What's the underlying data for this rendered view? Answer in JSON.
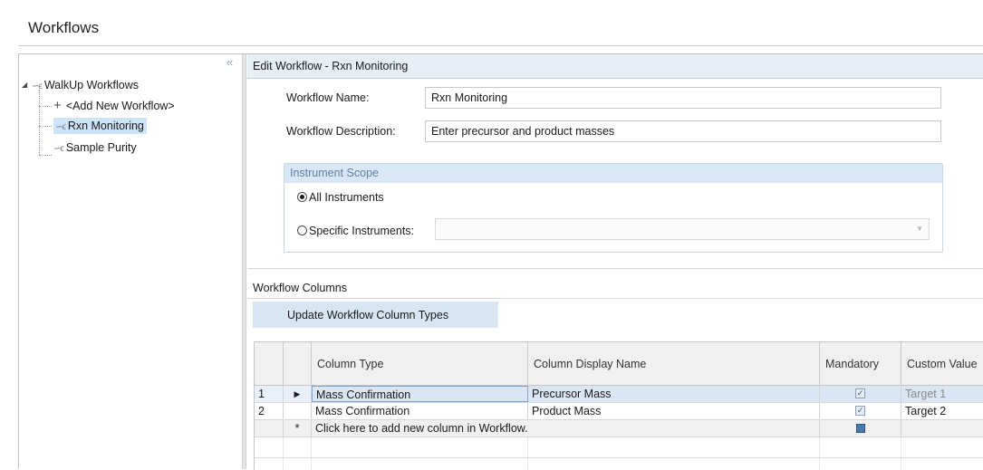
{
  "header": {
    "title": "Workflows"
  },
  "tree": {
    "root": "WalkUp Workflows",
    "items": [
      {
        "label": "<Add New Workflow>",
        "icon": "plus-icon"
      },
      {
        "label": "Rxn Monitoring",
        "icon": "workflow-icon",
        "selected": true
      },
      {
        "label": "Sample Purity",
        "icon": "workflow-icon"
      }
    ]
  },
  "edit": {
    "title": "Edit Workflow - Rxn Monitoring",
    "name_label": "Workflow Name:",
    "name_value": "Rxn Monitoring",
    "desc_label": "Workflow Description:",
    "desc_value": "Enter precursor and product masses"
  },
  "scope": {
    "title": "Instrument Scope",
    "all_label": "All Instruments",
    "specific_label": "Specific Instruments:",
    "selected": "All Instruments"
  },
  "columns": {
    "title": "Workflow Columns",
    "update_button": "Update Workflow Column Types",
    "headers": [
      "Column Type",
      "Column Display Name",
      "Mandatory",
      "Custom Value"
    ],
    "rows": [
      {
        "num": "1",
        "type": "Mass Confirmation",
        "display": "Precursor Mass",
        "mandatory": true,
        "custom": "Target 1"
      },
      {
        "num": "2",
        "type": "Mass Confirmation",
        "display": "Product Mass",
        "mandatory": true,
        "custom": "Target 2"
      }
    ],
    "new_row_marker": "*",
    "new_row_text": "Click here to add new column in Workflow."
  }
}
